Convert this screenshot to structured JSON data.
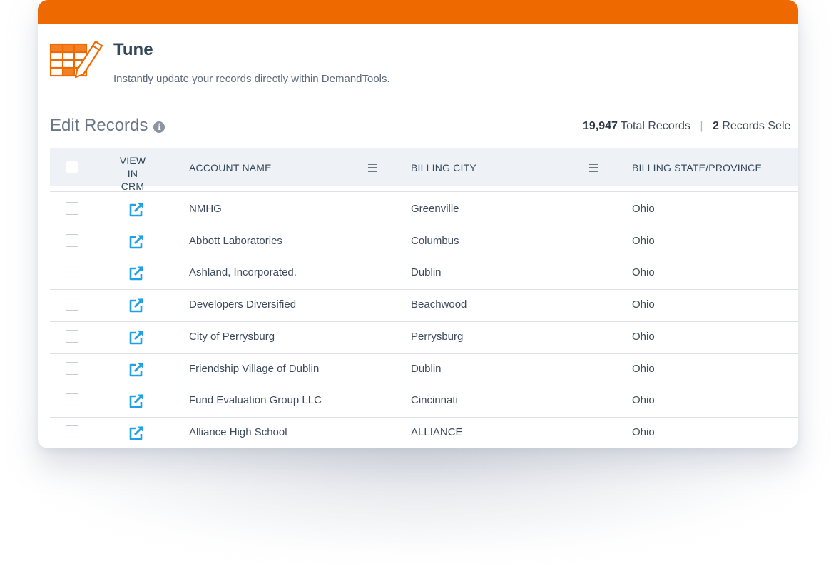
{
  "header": {
    "title": "Tune",
    "subtitle": "Instantly update your records directly within DemandTools."
  },
  "edit": {
    "title": "Edit Records",
    "info_icon": "info-icon",
    "total_count": "19,947",
    "total_label": "Total Records",
    "separator": "|",
    "selected_count": "2",
    "selected_label": "Records Sele"
  },
  "table": {
    "columns": {
      "view_line1": "VIEW",
      "view_line2": "IN CRM",
      "account": "ACCOUNT NAME",
      "city": "BILLING CITY",
      "state": "BILLING STATE/PROVINCE"
    },
    "rows": [
      {
        "account": "NMHG",
        "city": "Greenville",
        "state": "Ohio"
      },
      {
        "account": "Abbott Laboratories",
        "city": "Columbus",
        "state": "Ohio"
      },
      {
        "account": "Ashland, Incorporated.",
        "city": "Dublin",
        "state": "Ohio"
      },
      {
        "account": "Developers Diversified",
        "city": "Beachwood",
        "state": "Ohio"
      },
      {
        "account": "City of Perrysburg",
        "city": "Perrysburg",
        "state": "Ohio"
      },
      {
        "account": "Friendship Village of Dublin",
        "city": "Dublin",
        "state": "Ohio"
      },
      {
        "account": "Fund Evaluation Group LLC",
        "city": "Cincinnati",
        "state": "Ohio"
      },
      {
        "account": "Alliance High School",
        "city": "ALLIANCE",
        "state": "Ohio"
      }
    ]
  },
  "colors": {
    "accent": "#ee6a00",
    "link_icon": "#1fa1e6",
    "header_bg": "#eef1f5"
  },
  "icons": {
    "tune": "spreadsheet-pencil-icon",
    "view": "external-link-icon",
    "column_menu": "hamburger-menu-icon"
  }
}
